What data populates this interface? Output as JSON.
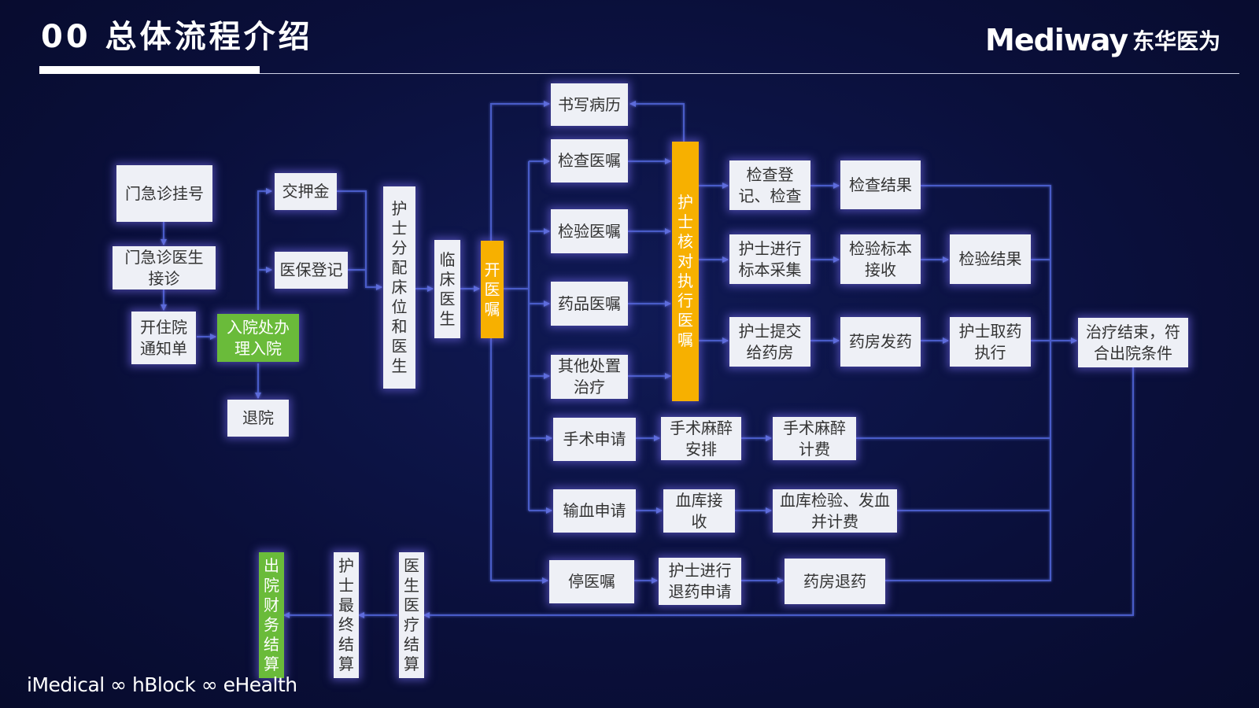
{
  "header": {
    "title": "00 总体流程介绍",
    "logo_latin": "Mediway",
    "logo_cn": "东华医为"
  },
  "footer": {
    "tagline": "iMedical ∞ hBlock ∞ eHealth"
  },
  "nodes": {
    "outpatient_register": "门急诊挂号",
    "outpatient_doctor": "门急诊医生接诊",
    "admission_notice": "开住院通知单",
    "admission_office": "入院处办理入院",
    "discharge_cancel": "退院",
    "deposit": "交押金",
    "insurance_register": "医保登记",
    "nurse_assign": "护士分配床位和医生",
    "clinical_doctor": "临床医生",
    "open_order": "开医嘱",
    "write_record": "书写病历",
    "exam_order": "检查医嘱",
    "lab_order": "检验医嘱",
    "drug_order": "药品医嘱",
    "other_treatment": "其他处置治疗",
    "nurse_verify": "护士核对执行医嘱",
    "exam_register": "检查登记、检查",
    "exam_result": "检查结果",
    "nurse_sample": "护士进行标本采集",
    "sample_receive": "检验标本接收",
    "lab_result": "检验结果",
    "nurse_submit_pharmacy": "护士提交给药房",
    "pharmacy_dispense": "药房发药",
    "nurse_take_drug": "护士取药执行",
    "treatment_end": "治疗结束，符合出院条件",
    "surgery_apply": "手术申请",
    "surgery_anesthesia": "手术麻醉安排",
    "surgery_billing": "手术麻醉计费",
    "blood_apply": "输血申请",
    "blood_receive": "血库接收",
    "blood_test_issue": "血库检验、发血并计费",
    "stop_order": "停医嘱",
    "nurse_return_apply": "护士进行退药申请",
    "pharmacy_return": "药房退药",
    "doctor_settlement": "医生医疗结算",
    "nurse_final_settlement": "护士最终结算",
    "discharge_finance": "出院财务结算"
  },
  "colors": {
    "background": "#0a0f3a",
    "box": "#eef0f6",
    "highlight_green": "#6abb3a",
    "highlight_orange": "#f7b000",
    "connector": "#4a5cc8"
  }
}
